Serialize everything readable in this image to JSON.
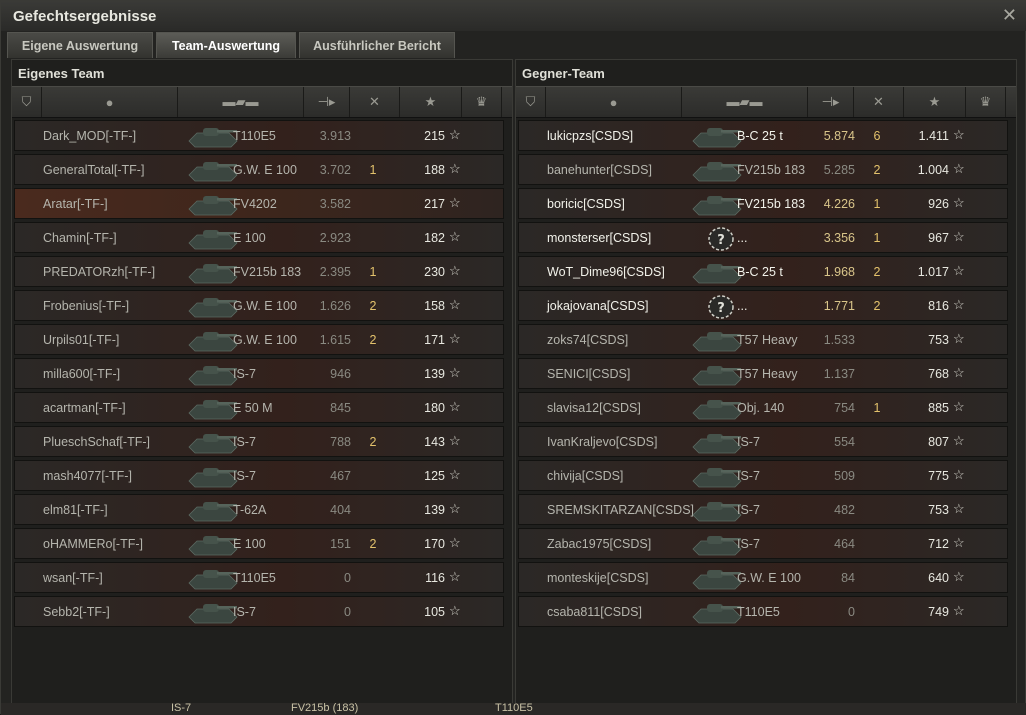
{
  "window": {
    "title": "Gefechtsergebnisse",
    "close_icon": "close-icon"
  },
  "tabs": [
    {
      "label": "Eigene Auswertung",
      "active": false
    },
    {
      "label": "Team-Auswertung",
      "active": true
    },
    {
      "label": "Ausführlicher Bericht",
      "active": false
    }
  ],
  "left": {
    "title": "Eigenes Team",
    "rows": [
      {
        "name": "Dark_MOD[-TF-]",
        "tank": "T110E5",
        "damage": "3.913",
        "kills": "",
        "xp": "215",
        "alive": false,
        "own": false
      },
      {
        "name": "GeneralTotal[-TF-]",
        "tank": "G.W. E 100",
        "damage": "3.702",
        "kills": "1",
        "xp": "188",
        "alive": false,
        "own": false
      },
      {
        "name": "Aratar[-TF-]",
        "tank": "FV4202",
        "damage": "3.582",
        "kills": "",
        "xp": "217",
        "alive": false,
        "own": true
      },
      {
        "name": "Chamin[-TF-]",
        "tank": "E 100",
        "damage": "2.923",
        "kills": "",
        "xp": "182",
        "alive": false,
        "own": false
      },
      {
        "name": "PREDATORzh[-TF-]",
        "tank": "FV215b 183",
        "damage": "2.395",
        "kills": "1",
        "xp": "230",
        "alive": false,
        "own": false
      },
      {
        "name": "Frobenius[-TF-]",
        "tank": "G.W. E 100",
        "damage": "1.626",
        "kills": "2",
        "xp": "158",
        "alive": false,
        "own": false
      },
      {
        "name": "Urpils01[-TF-]",
        "tank": "G.W. E 100",
        "damage": "1.615",
        "kills": "2",
        "xp": "171",
        "alive": false,
        "own": false
      },
      {
        "name": "milla600[-TF-]",
        "tank": "IS-7",
        "damage": "946",
        "kills": "",
        "xp": "139",
        "alive": false,
        "own": false
      },
      {
        "name": "acartman[-TF-]",
        "tank": "E 50 M",
        "damage": "845",
        "kills": "",
        "xp": "180",
        "alive": false,
        "own": false
      },
      {
        "name": "PlueschSchaf[-TF-]",
        "tank": "IS-7",
        "damage": "788",
        "kills": "2",
        "xp": "143",
        "alive": false,
        "own": false
      },
      {
        "name": "mash4077[-TF-]",
        "tank": "IS-7",
        "damage": "467",
        "kills": "",
        "xp": "125",
        "alive": false,
        "own": false
      },
      {
        "name": "elm81[-TF-]",
        "tank": "T-62A",
        "damage": "404",
        "kills": "",
        "xp": "139",
        "alive": false,
        "own": false
      },
      {
        "name": "oHAMMERo[-TF-]",
        "tank": "E 100",
        "damage": "151",
        "kills": "2",
        "xp": "170",
        "alive": false,
        "own": false
      },
      {
        "name": "wsan[-TF-]",
        "tank": "T110E5",
        "damage": "0",
        "kills": "",
        "xp": "116",
        "alive": false,
        "own": false
      },
      {
        "name": "Sebb2[-TF-]",
        "tank": "IS-7",
        "damage": "0",
        "kills": "",
        "xp": "105",
        "alive": false,
        "own": false
      }
    ]
  },
  "right": {
    "title": "Gegner-Team",
    "rows": [
      {
        "name": "lukicpzs[CSDS]",
        "tank": "B-C 25 t",
        "damage": "5.874",
        "kills": "6",
        "xp": "1.411",
        "alive": true,
        "own": false
      },
      {
        "name": "banehunter[CSDS]",
        "tank": "FV215b 183",
        "damage": "5.285",
        "kills": "2",
        "xp": "1.004",
        "alive": false,
        "own": false
      },
      {
        "name": "boricic[CSDS]",
        "tank": "FV215b 183",
        "damage": "4.226",
        "kills": "1",
        "xp": "926",
        "alive": true,
        "own": false
      },
      {
        "name": "monsterser[CSDS]",
        "tank": "...",
        "damage": "3.356",
        "kills": "1",
        "xp": "967",
        "alive": true,
        "own": false
      },
      {
        "name": "WoT_Dime96[CSDS]",
        "tank": "B-C 25 t",
        "damage": "1.968",
        "kills": "2",
        "xp": "1.017",
        "alive": true,
        "own": false
      },
      {
        "name": "jokajovana[CSDS]",
        "tank": "...",
        "damage": "1.771",
        "kills": "2",
        "xp": "816",
        "alive": true,
        "own": false
      },
      {
        "name": "zoks74[CSDS]",
        "tank": "T57 Heavy",
        "damage": "1.533",
        "kills": "",
        "xp": "753",
        "alive": false,
        "own": false
      },
      {
        "name": "SENICI[CSDS]",
        "tank": "T57 Heavy",
        "damage": "1.137",
        "kills": "",
        "xp": "768",
        "alive": false,
        "own": false
      },
      {
        "name": "slavisa12[CSDS]",
        "tank": "Obj. 140",
        "damage": "754",
        "kills": "1",
        "xp": "885",
        "alive": false,
        "own": false
      },
      {
        "name": "IvanKraljevo[CSDS]",
        "tank": "IS-7",
        "damage": "554",
        "kills": "",
        "xp": "807",
        "alive": false,
        "own": false
      },
      {
        "name": "chivija[CSDS]",
        "tank": "IS-7",
        "damage": "509",
        "kills": "",
        "xp": "775",
        "alive": false,
        "own": false
      },
      {
        "name": "SREMSKITARZAN[CSDS]",
        "tank": "IS-7",
        "damage": "482",
        "kills": "",
        "xp": "753",
        "alive": false,
        "own": false
      },
      {
        "name": "Zabac1975[CSDS]",
        "tank": "IS-7",
        "damage": "464",
        "kills": "",
        "xp": "712",
        "alive": false,
        "own": false
      },
      {
        "name": "monteskije[CSDS]",
        "tank": "G.W. E 100",
        "damage": "84",
        "kills": "",
        "xp": "640",
        "alive": false,
        "own": false
      },
      {
        "name": "csaba811[CSDS]",
        "tank": "T110E5",
        "damage": "0",
        "kills": "",
        "xp": "749",
        "alive": false,
        "own": false
      }
    ]
  },
  "bottom_strip": [
    "IS-7",
    "FV215b (183)",
    "T110E5"
  ],
  "colors": {
    "accent": "#e3c26c",
    "own_row": "#4a2a1e"
  }
}
